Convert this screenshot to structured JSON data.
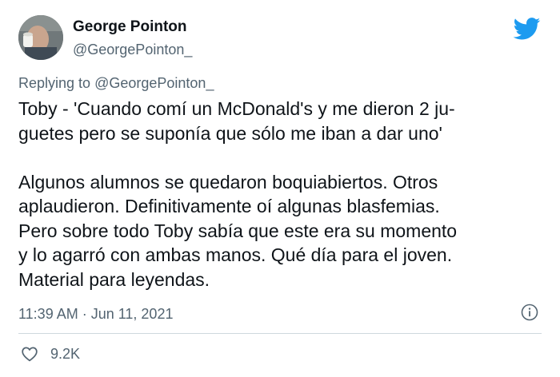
{
  "user": {
    "display_name": "George Pointon",
    "handle": "@GeorgePointon_"
  },
  "reply": {
    "prefix": "Replying to",
    "mention": "@GeorgePointon_"
  },
  "tweet": {
    "lines": [
      "Toby - 'Cuando comí un McDonald's y me dieron 2 ju-",
      "guetes pero se suponía que sólo me iban a dar uno'",
      "Algunos alumnos se quedaron boquiabiertos. Otros",
      "aplaudieron. Definitivamente oí algunas blasfemias.",
      "Pero sobre todo Toby sabía que este era su momento",
      "y lo agarró con ambas manos. Qué día para el joven.",
      "Material para leyendas."
    ]
  },
  "meta": {
    "timestamp": "11:39 AM · Jun 11, 2021",
    "likes": "9.2K"
  },
  "icons": {
    "brand": "twitter-bird-icon",
    "info": "info-icon",
    "like": "heart-icon"
  },
  "colors": {
    "twitter_blue": "#1d9bf0",
    "secondary_text": "#536471",
    "primary_text": "#0f1419",
    "divider": "#cfd9de"
  }
}
